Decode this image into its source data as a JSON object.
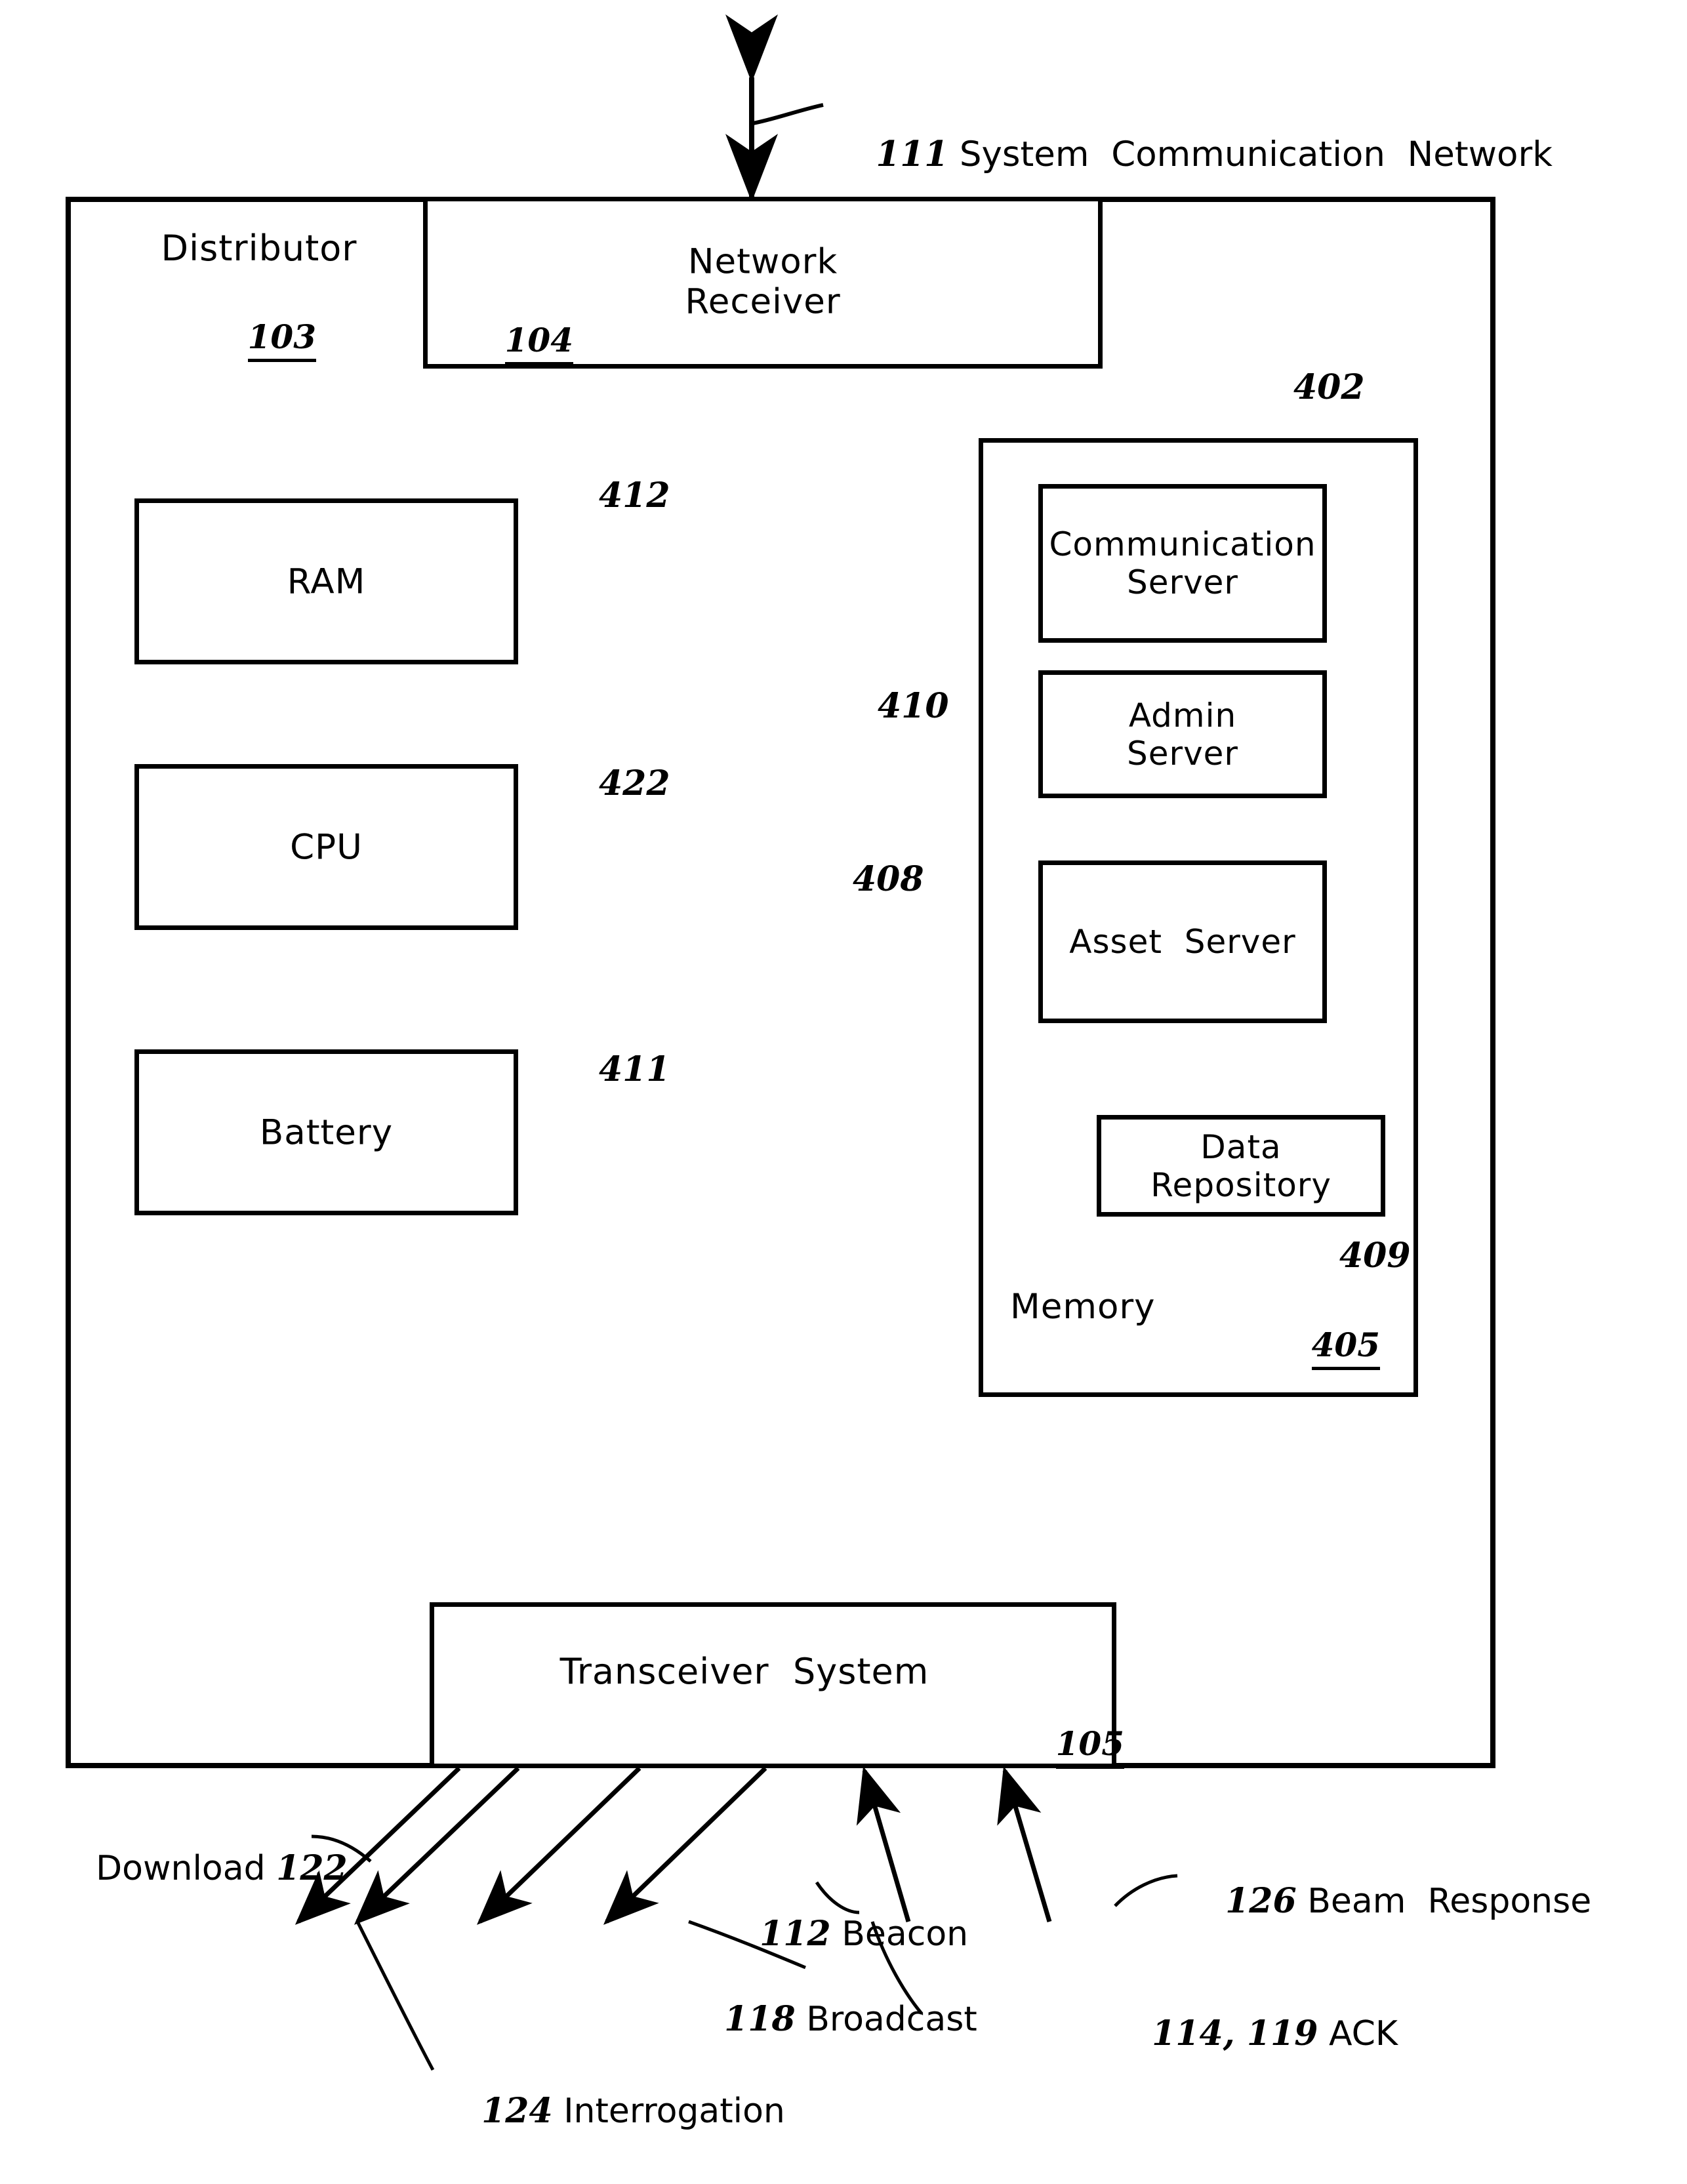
{
  "figure": {
    "type": "patent-block-diagram",
    "top_callout": {
      "numeral": "111",
      "caption": " System  Communication  Network"
    },
    "outer_block": {
      "title": "Distributor",
      "numeral": "103"
    },
    "blocks": {
      "network_receiver": {
        "label": "Network\nReceiver",
        "numeral": "104"
      },
      "ram": {
        "label": "RAM",
        "numeral": "412"
      },
      "cpu": {
        "label": "CPU",
        "numeral": "422"
      },
      "battery": {
        "label": "Battery",
        "numeral": "411"
      },
      "memory": {
        "label": "Memory",
        "numeral": "405"
      },
      "communication_server": {
        "label": "Communication\nServer",
        "numeral": "402"
      },
      "admin_server": {
        "label": "Admin\nServer",
        "numeral": "410"
      },
      "asset_server": {
        "label": "Asset  Server",
        "numeral": "408"
      },
      "data_repository": {
        "label": "Data\nRepository",
        "numeral": "409"
      },
      "transceiver": {
        "label": "Transceiver  System",
        "numeral": "105"
      }
    },
    "signals": [
      {
        "id": "download",
        "numeral": "122",
        "caption": "Download ",
        "direction": "out"
      },
      {
        "id": "interrogation",
        "numeral": "124",
        "caption": " Interrogation",
        "direction": "out"
      },
      {
        "id": "beacon",
        "numeral": "112",
        "caption": " Beacon",
        "direction": "out"
      },
      {
        "id": "broadcast",
        "numeral": "118",
        "caption": " Broadcast",
        "direction": "out"
      },
      {
        "id": "ack",
        "numeral": "114, 119",
        "caption": " ACK",
        "direction": "in"
      },
      {
        "id": "beam_response",
        "numeral": "126",
        "caption": " Beam  Response",
        "direction": "in"
      }
    ],
    "colors": {
      "ink": "#000000",
      "paper": "#ffffff"
    }
  }
}
